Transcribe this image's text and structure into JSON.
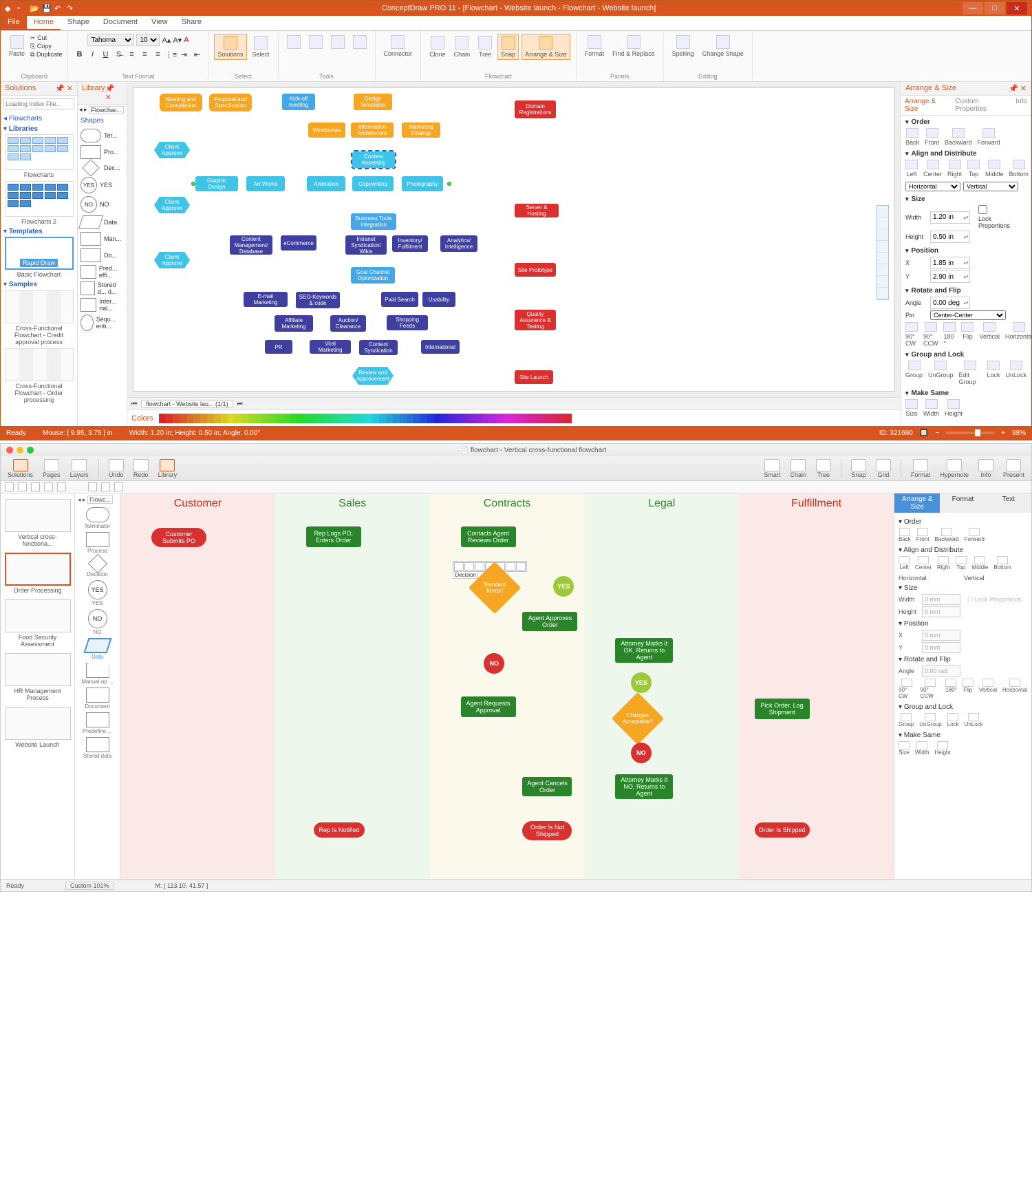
{
  "win": {
    "title": "ConceptDraw PRO 11 - [Flowchart - Website launch - Flowchart - Website launch]",
    "tabs": {
      "file": "File",
      "home": "Home",
      "shape": "Shape",
      "document": "Document",
      "view": "View",
      "share": "Share"
    },
    "clipboard": {
      "paste": "Paste",
      "cut": "Cut",
      "copy": "Copy",
      "duplicate": "Duplicate",
      "label": "Clipboard"
    },
    "font_name": "Tahoma",
    "font_size": "10",
    "text_format_label": "Text Format",
    "select": {
      "solutions": "Solutions",
      "select": "Select",
      "label": "Select"
    },
    "tools": {
      "label": "Tools"
    },
    "connector_label": "Connector",
    "flowchart_group": [
      "Clone",
      "Chain",
      "Tree",
      "Snap",
      "Arrange & Size"
    ],
    "flowchart_label": "Flowchart",
    "panels": {
      "format": "Format",
      "find": "Find & Replace",
      "label": "Panels"
    },
    "editing": {
      "spelling": "Spelling",
      "change": "Change Shape",
      "label": "Editing"
    }
  },
  "solutions": {
    "header": "Solutions",
    "search_placeholder": "Loading Index File...",
    "flowcharts": "Flowcharts",
    "libraries": "Libraries",
    "flowcharts_caption": "Flowcharts",
    "flowcharts2_caption": "Flowcharts 2",
    "templates": "Templates",
    "rapid_draw": "Rapid Draw",
    "basic_flowchart": "Basic Flowchart",
    "samples": "Samples",
    "cfc_credit": "Cross-Functional Flowchart - Credit approval process",
    "cfc_order": "Cross-Functional Flowchart - Order processing"
  },
  "library": {
    "header": "Library",
    "dropdown": "Flowchar...",
    "shapes": "Shapes",
    "items": [
      "Ter...",
      "Pro...",
      "Dec...",
      "YES",
      "NO",
      "Data",
      "Man...",
      "Do...",
      "Pred... effi...",
      "Stored d... d...",
      "Inter... nal...",
      "Sequ... enti..."
    ]
  },
  "canvas": {
    "tab": "flowchart - Website lau...  (1/1)",
    "nodes": {
      "meeting": "Meeting and Consultation",
      "proposal": "Proposal and Specification",
      "kickoff": "Kick-off meeting",
      "design": "Design Templates",
      "wireframes": "Wireframes",
      "infoarch": "Information Architecture",
      "marketing": "Marketing Strategy",
      "approve1": "Client Approve",
      "approve2": "Client Approve",
      "approve3": "Client Approve",
      "content_assembly": "Content Assembly",
      "graphic": "Graphic Design",
      "artworks": "Art Works",
      "animation": "Animation",
      "copywriting": "Copywriting",
      "photography": "Photography",
      "biztools": "Business Tools Integration",
      "cmdb": "Content Management/ Database",
      "ecommerce": "eCommerce",
      "intranet": "Intranet Syndication/ Wikis",
      "inventory": "Inventory/ Fulfilment",
      "analytics": "Analytics/ Intelligence",
      "goal": "Goal Channel Optimization",
      "email": "E-mail Marketing",
      "seo": "SEO-Keywords & code",
      "paid": "Paid Search",
      "usability": "Usability",
      "affiliate": "Affiliate Marketing",
      "auction": "Auction/ Clearance",
      "shopfeeds": "Shopping Feeds",
      "pr": "PR",
      "viral": "Viral Marketing",
      "syndication": "Content Syndication",
      "international": "International",
      "review": "Review and Approvement",
      "domain": "Domain Registrations",
      "server": "Server & Hosting",
      "proto": "Site Prototype",
      "qa": "Quality Assurance & Testing",
      "launch": "Site Launch"
    }
  },
  "colors_label": "Colors",
  "arrange": {
    "header": "Arrange & Size",
    "tabs": {
      "main": "Arrange & Size",
      "custom": "Custom Properties",
      "info": "Info"
    },
    "order": {
      "hdr": "Order",
      "back": "Back",
      "front": "Front",
      "backward": "Backward",
      "forward": "Forward"
    },
    "align": {
      "hdr": "Align and Distribute",
      "left": "Left",
      "center": "Center",
      "right": "Right",
      "top": "Top",
      "middle": "Middle",
      "bottom": "Bottom",
      "horiz": "Horizontal",
      "vert": "Vertical"
    },
    "size": {
      "hdr": "Size",
      "width": "Width",
      "wval": "1.20 in",
      "height": "Height",
      "hval": "0.50 in",
      "lock": "Lock Proportions"
    },
    "position": {
      "hdr": "Position",
      "x": "X",
      "xval": "1.85 in",
      "y": "Y",
      "yval": "2.90 in"
    },
    "rotate": {
      "hdr": "Rotate and Flip",
      "angle": "Angle",
      "aval": "0.00 deg",
      "pin": "Pin",
      "pval": "Center-Center",
      "cw": "90° CW",
      "ccw": "90° CCW",
      "r180": "180 °",
      "flip": "Flip",
      "vert": "Vertical",
      "horiz": "Horizontal"
    },
    "group": {
      "hdr": "Group and Lock",
      "group": "Group",
      "ungroup": "UnGroup",
      "edit": "Edit Group",
      "lock": "Lock",
      "unlock": "UnLock"
    },
    "same": {
      "hdr": "Make Same",
      "size": "Size",
      "width": "Width",
      "height": "Height"
    }
  },
  "status": {
    "ready": "Ready",
    "mouse": "Mouse: [ 9.95, 3.75 ] in",
    "dims": "Width: 1.20 in; Height: 0.50 in; Angle: 0.00°",
    "id": "ID: 321690",
    "zoom": "98%"
  },
  "mac": {
    "title": "flowchart - Vertical cross-functional flowchart",
    "toolbar": {
      "solutions": "Solutions",
      "pages": "Pages",
      "layers": "Layers",
      "undo": "Undo",
      "redo": "Redo",
      "library": "Library",
      "smart": "Smart",
      "chain": "Chain",
      "tree": "Tree",
      "snap": "Snap",
      "grid": "Grid",
      "format": "Format",
      "hypernote": "Hypernote",
      "info": "Info",
      "present": "Present"
    },
    "crumb": "Flowc...",
    "left": {
      "vcf": "Vertical cross-functiona...",
      "order": "Order Processing",
      "food": "Food Security Assessment",
      "hr": "HR Management Process",
      "web": "Website Launch"
    },
    "lib": [
      "Terminator",
      "Process",
      "Decision",
      "YES",
      "NO",
      "Data",
      "Manual op ...",
      "Document",
      "Predefine ...",
      "Stored data"
    ],
    "lanes": [
      "Customer",
      "Sales",
      "Contracts",
      "Legal",
      "Fulfillment"
    ],
    "nodes": {
      "submit": "Customer Submits PO",
      "replog": "Rep Logs PO, Enters Order",
      "contacts": "Contacts Agent Reviews Order",
      "decision_label": "Decision",
      "standard": "Standard Terms?",
      "yes": "YES",
      "no": "NO",
      "approves": "Agent Approves Order",
      "attok": "Attorney Marks It OK, Returns to Agent",
      "changes": "Changes Acceptable?",
      "pick": "Pick Order, Log Shipment",
      "requests": "Agent Requests Approval",
      "attno": "Attorney Marks It NO, Returns to Agent",
      "cancels": "Agent Cancels Order",
      "repnotif": "Rep Is Notified",
      "notshipped": "Order Is Not Shipped",
      "shipped": "Order Is Shipped"
    },
    "right": {
      "tabs": {
        "arrange": "Arrange & Size",
        "format": "Format",
        "text": "Text"
      },
      "order": {
        "hdr": "Order",
        "back": "Back",
        "front": "Front",
        "backward": "Backward",
        "forward": "Forward"
      },
      "align": {
        "hdr": "Align and Distribute",
        "left": "Left",
        "center": "Center",
        "right": "Right",
        "top": "Top",
        "middle": "Middle",
        "bottom": "Bottom",
        "horiz": "Horizontal",
        "vert": "Vertical"
      },
      "size": {
        "hdr": "Size",
        "width": "Width",
        "wval": "0 mm",
        "height": "Height",
        "hval": "0 mm",
        "lock": "Lock Proportions"
      },
      "position": {
        "hdr": "Position",
        "x": "X",
        "xval": "0 mm",
        "y": "Y",
        "yval": "0 mm"
      },
      "rotate": {
        "hdr": "Rotate and Flip",
        "angle": "Angle",
        "aval": "0.00 rad",
        "cw": "90° CW",
        "ccw": "90° CCW",
        "r180": "180°",
        "flip": "Flip",
        "vert": "Vertical",
        "horiz": "Horizontal"
      },
      "group": {
        "hdr": "Group and Lock",
        "group": "Group",
        "ungroup": "UnGroup",
        "lock": "Lock",
        "unlock": "UnLock"
      },
      "same": {
        "hdr": "Make Same",
        "size": "Size",
        "width": "Width",
        "height": "Height"
      }
    },
    "status": {
      "ready": "Ready",
      "custom": "Custom 101%",
      "mouse": "M: [ 113.10, 41.57 ]"
    }
  }
}
